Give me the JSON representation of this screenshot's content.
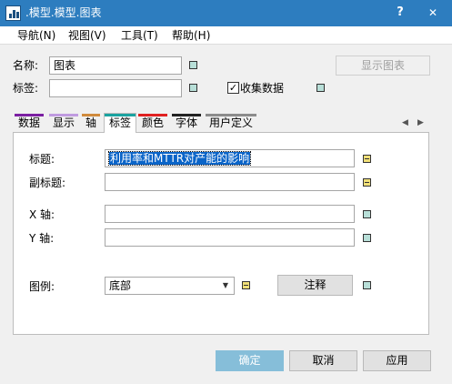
{
  "window": {
    "title": ".模型.模型.图表",
    "help_button": "?",
    "close_button": "✕"
  },
  "menu": [
    "导航(N)",
    "视图(V)",
    "工具(T)",
    "帮助(H)"
  ],
  "form": {
    "name_label": "名称:",
    "name_value": "图表",
    "tag_label": "标签:",
    "tag_value": "",
    "show_chart_button": "显示图表",
    "collect_data_label": "收集数据",
    "collect_data_checked": "✓"
  },
  "tabs": {
    "items": [
      {
        "label": "数据",
        "color": "#7b1fa2"
      },
      {
        "label": "显示",
        "color": "#c09be0"
      },
      {
        "label": "轴",
        "color": "#d08a3c"
      },
      {
        "label": "标签",
        "color": "#1aa3a0"
      },
      {
        "label": "颜色",
        "color": "#e02020"
      },
      {
        "label": "字体",
        "color": "#222222"
      },
      {
        "label": "用户定义",
        "color": "#8c8c8c"
      }
    ],
    "active": "标签",
    "scroll_left": "◀",
    "scroll_right": "▶"
  },
  "labels_tab": {
    "title_label": "标题:",
    "title_value": "利用率和MTTR对产能的影响",
    "subtitle_label": "副标题:",
    "subtitle_value": "",
    "xaxis_label": "X 轴:",
    "xaxis_value": "",
    "yaxis_label": "Y 轴:",
    "yaxis_value": "",
    "legend_label": "图例:",
    "legend_value": "底部",
    "legend_arrow": "▼",
    "annotate_button": "注释"
  },
  "footer": {
    "ok_button": "确定",
    "cancel_button": "取消",
    "apply_button": "应用"
  }
}
